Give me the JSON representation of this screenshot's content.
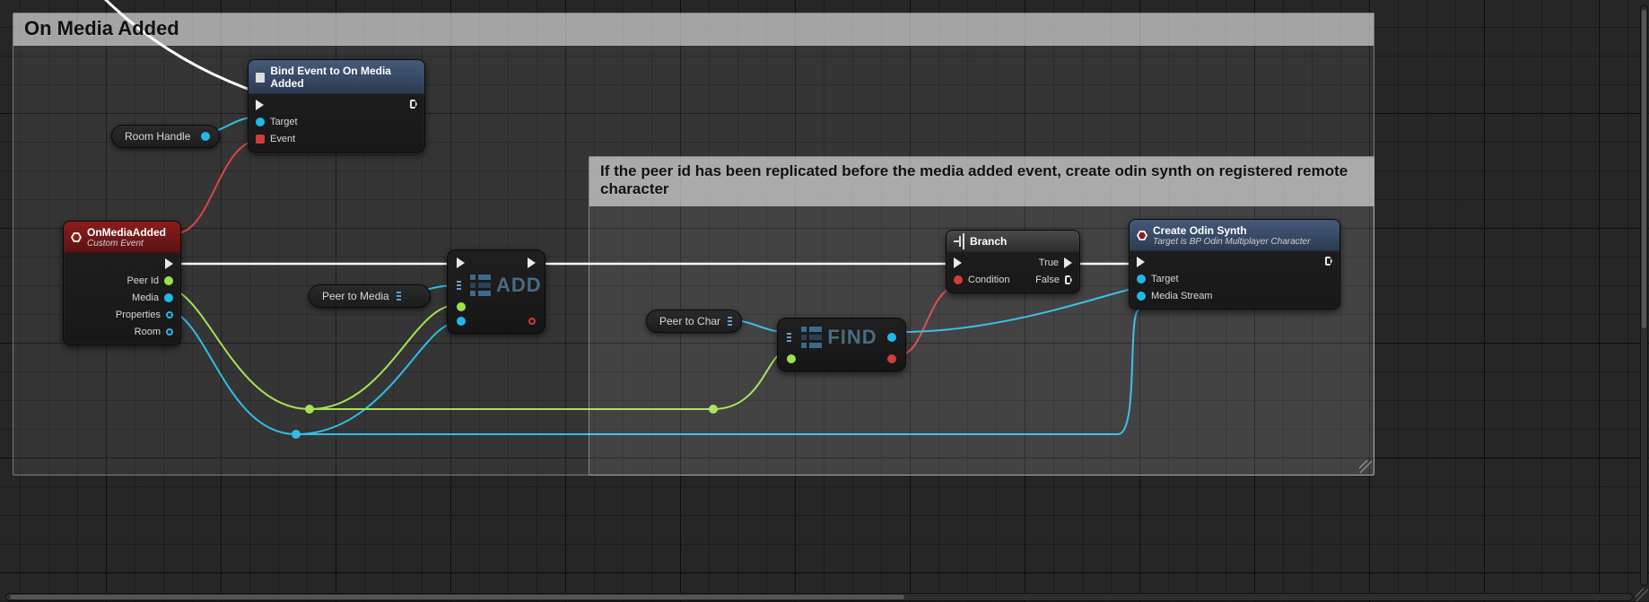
{
  "comment_main": {
    "title": "On Media Added"
  },
  "comment_inner": {
    "title": "If the peer id has been replicated before the media added event, create odin synth on registered remote character"
  },
  "var_room_handle": {
    "label": "Room Handle"
  },
  "var_peer_to_media": {
    "label": "Peer to Media"
  },
  "var_peer_to_char": {
    "label": "Peer to Char"
  },
  "node_bind": {
    "title": "Bind Event to On Media Added",
    "pin_target": "Target",
    "pin_event": "Event"
  },
  "node_event": {
    "title": "OnMediaAdded",
    "subtitle": "Custom Event",
    "pin_peer_id": "Peer Id",
    "pin_media": "Media",
    "pin_properties": "Properties",
    "pin_room": "Room"
  },
  "node_add": {
    "label": "ADD"
  },
  "node_find": {
    "label": "FIND"
  },
  "node_branch": {
    "title": "Branch",
    "pin_condition": "Condition",
    "pin_true": "True",
    "pin_false": "False"
  },
  "node_create": {
    "title": "Create Odin Synth",
    "subtitle": "Target is BP Odin Multiplayer Character",
    "pin_target": "Target",
    "pin_media_stream": "Media Stream"
  }
}
